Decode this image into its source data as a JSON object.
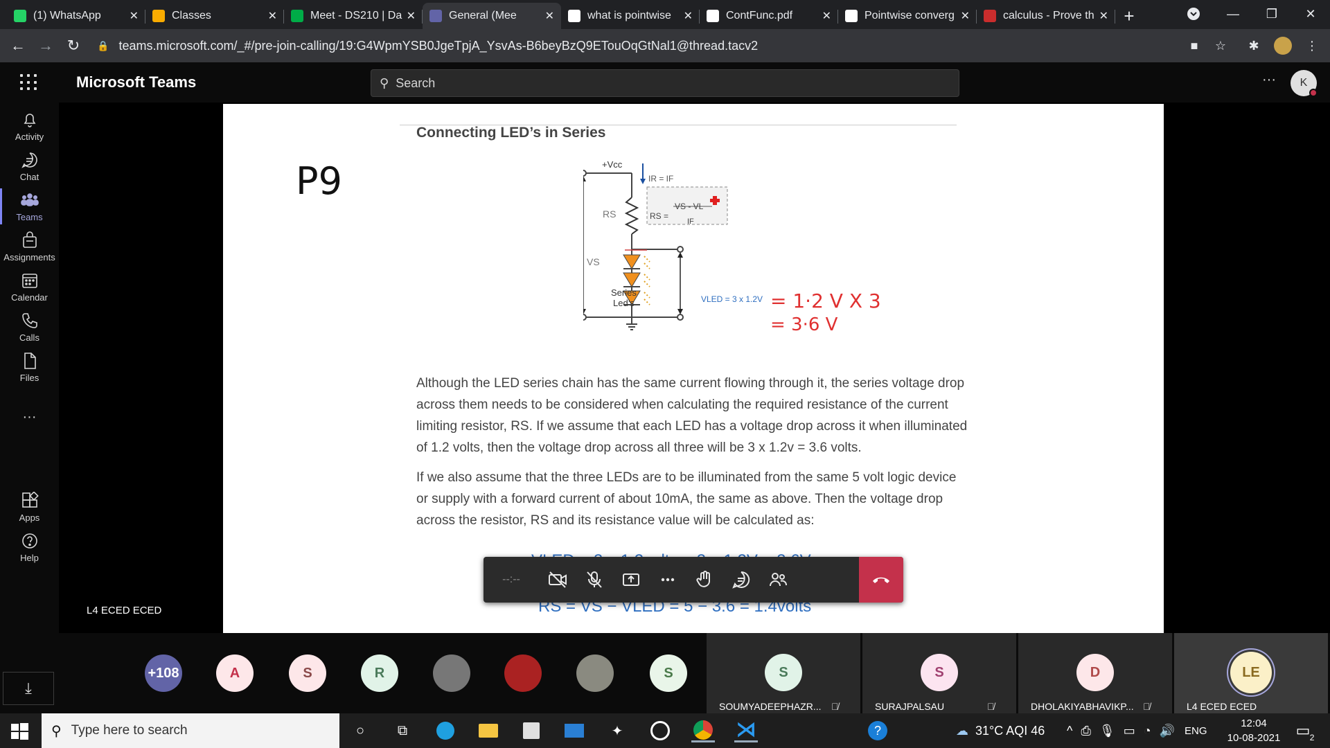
{
  "browser": {
    "tabs": [
      {
        "title": "(1) WhatsApp",
        "favicon": "whatsapp-icon",
        "color": "#25d366"
      },
      {
        "title": "Classes",
        "favicon": "classroom-icon",
        "color": "#f9ab00"
      },
      {
        "title": "Meet - DS210 | Da",
        "favicon": "meet-icon",
        "color": "#00ac47"
      },
      {
        "title": "General (Mee",
        "favicon": "teams-icon",
        "color": "#6264a7",
        "active": true
      },
      {
        "title": "what is pointwise",
        "favicon": "google-icon",
        "color": "#ffffff"
      },
      {
        "title": "ContFunc.pdf",
        "favicon": "pdf-icon",
        "color": "#ffffff"
      },
      {
        "title": "Pointwise converg",
        "favicon": "wikipedia-icon",
        "color": "#ffffff"
      },
      {
        "title": "calculus - Prove th",
        "favicon": "stackexchange-icon",
        "color": "#ca2d2d"
      }
    ],
    "new_tab": "+",
    "url": "teams.microsoft.com/_#/pre-join-calling/19:G4WpmYSB0JgeTpjA_YsvAs-B6beyBzQ9ETouOqGtNal1@thread.tacv2"
  },
  "teams": {
    "title": "Microsoft Teams",
    "search_placeholder": "Search",
    "avatar_initial": "K",
    "more": "···"
  },
  "rail": [
    {
      "label": "Activity",
      "icon": "bell-icon"
    },
    {
      "label": "Chat",
      "icon": "chat-icon"
    },
    {
      "label": "Teams",
      "icon": "teams-icon",
      "active": true
    },
    {
      "label": "Assignments",
      "icon": "assignments-icon"
    },
    {
      "label": "Calendar",
      "icon": "calendar-icon"
    },
    {
      "label": "Calls",
      "icon": "phone-icon"
    },
    {
      "label": "Files",
      "icon": "file-icon"
    },
    {
      "label": "Apps",
      "icon": "apps-icon"
    },
    {
      "label": "Help",
      "icon": "help-icon"
    }
  ],
  "rail_more": "···",
  "stage_label": "L4 ECED ECED",
  "shared_doc": {
    "heading": "Connecting LED’s in Series",
    "handwriting_p9": "P9",
    "circuit": {
      "vcc": "+Vcc",
      "current": "IR = IF",
      "rs": "RS",
      "rs_formula_left": "RS =",
      "rs_formula_num": "VS - VL",
      "rs_formula_den": "IF",
      "vs": "VS",
      "series_leds_1": "Series",
      "series_leds_2": "Led’s",
      "vled": "VLED = 3 x 1.2V",
      "handwriting_1": "= 1·2 V X 3",
      "handwriting_2": "= 3·6 V"
    },
    "para1": "Although the LED series chain has the same current flowing through it, the series voltage drop across them needs to be considered when calculating the required resistance of the current limiting resistor, RS. If we assume that each LED has a voltage drop across it when illuminated of 1.2 volts, then the voltage drop across all three will be 3 x 1.2v = 3.6 volts.",
    "para2": "If we also assume that the three LEDs are to be illuminated from the same 5 volt logic device or supply with a forward current of about 10mA, the same as above. Then the voltage drop across the resistor, RS and its resistance value will be calculated as:",
    "formula_top": "VLED = 3 x 1.2volts = 3 x 1.2V = 3.6V",
    "formula_bottom": "RS = VS − VLED = 5 − 3.6 = 1.4volts"
  },
  "meeting_controls": {
    "timer": "--:--",
    "buttons": [
      "camera-off-icon",
      "mic-off-icon",
      "share-icon",
      "more-icon",
      "raise-hand-icon",
      "chat-icon",
      "participants-icon"
    ],
    "hangup": "hang-up-icon"
  },
  "participants": [
    {
      "initial": "+108",
      "bg": "#6264a7",
      "fg": "#ffffff"
    },
    {
      "initial": "A",
      "bg": "#fde7e9",
      "fg": "#c4314b"
    },
    {
      "initial": "S",
      "bg": "#fde7e9",
      "fg": "#8b4a4a"
    },
    {
      "initial": "R",
      "bg": "#e1f3e8",
      "fg": "#4a7a5a"
    },
    {
      "initial": "",
      "bg": "#777777",
      "photo": "photo-avatar-icon"
    },
    {
      "initial": "",
      "bg": "#aa2222",
      "photo": "car-avatar-icon"
    },
    {
      "initial": "",
      "bg": "#8a8a80",
      "photo": "cat-avatar-icon"
    },
    {
      "initial": "S",
      "bg": "#e9f5e9",
      "fg": "#4a7a4a"
    }
  ],
  "named_participants": [
    {
      "initial": "S",
      "name": "SOUMYADEEPHAZR...",
      "bg": "#e1f3e8",
      "fg": "#4a7a5a",
      "muted": true
    },
    {
      "initial": "S",
      "name": "SURAJPALSAU",
      "bg": "#fce4f0",
      "fg": "#a04070",
      "muted": true
    },
    {
      "initial": "D",
      "name": "DHOLAKIYABHAVIKP...",
      "bg": "#fde7e9",
      "fg": "#b04a4a",
      "muted": true
    },
    {
      "initial": "LE",
      "name": "L4 ECED ECED",
      "bg": "#fbf0c8",
      "fg": "#8a6a20",
      "muted": false,
      "speaking": true
    }
  ],
  "taskbar": {
    "search_placeholder": "Type here to search",
    "weather": "31°C  AQI 46",
    "language": "ENG",
    "time": "12:04",
    "date": "10-08-2021",
    "notifications": "2"
  }
}
